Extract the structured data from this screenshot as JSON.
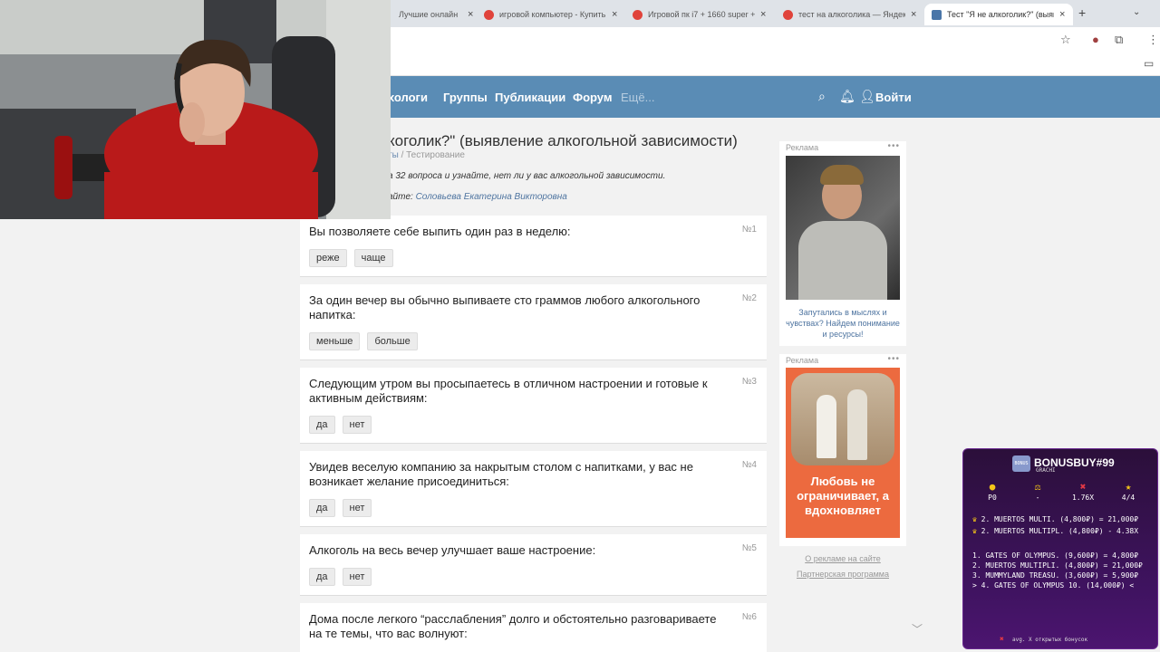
{
  "tabs": [
    {
      "title": "Лучшие онлайн",
      "favicon_color": "#888888"
    },
    {
      "title": "игровой компьютер - Купить",
      "favicon_color": "#e0433b"
    },
    {
      "title": "Игровой пк i7 + 1660 super +",
      "favicon_color": "#e0433b"
    },
    {
      "title": "тест на алкоголика — Яндекс",
      "favicon_color": "#e0433b"
    },
    {
      "title": "Тест \"Я не алкоголик?\" (выявл",
      "favicon_color": "#4a76a8"
    }
  ],
  "nav": {
    "links": [
      "хологи",
      "Группы",
      "Публикации",
      "Форум"
    ],
    "more": "Ещё...",
    "login": "Войти"
  },
  "page": {
    "title": "коголик?\" (выявление алкогольной зависимости)",
    "crumb_prefix": "ты",
    "crumb_current": "/ Тестирование",
    "intro": "а 32 вопроса и узнайте, нет ли у вас алкогольной зависимости.",
    "author_label": "айте:",
    "author_name": "Соловьева Екатерина Викторовна"
  },
  "questions": [
    {
      "num": "№1",
      "text": "Вы позволяете себе выпить один раз в неделю:",
      "options": [
        "реже",
        "чаще"
      ]
    },
    {
      "num": "№2",
      "text": "За один вечер вы обычно выпиваете сто граммов любого алкогольного напитка:",
      "options": [
        "меньше",
        "больше"
      ]
    },
    {
      "num": "№3",
      "text": "Следующим утром вы просыпаетесь в отличном настроении и готовые к активным действиям:",
      "options": [
        "да",
        "нет"
      ]
    },
    {
      "num": "№4",
      "text": "Увидев веселую компанию за накрытым столом с напитками, у вас не возникает желание присоединиться:",
      "options": [
        "да",
        "нет"
      ]
    },
    {
      "num": "№5",
      "text": "Алкоголь на весь вечер улучшает ваше настроение:",
      "options": [
        "да",
        "нет"
      ]
    },
    {
      "num": "№6",
      "text": "Дома после легкого “расслабления” долго и обстоятельно разговариваете на те темы, что вас волнуют:",
      "options": []
    }
  ],
  "ads": [
    {
      "label": "Реклама",
      "more": "•••",
      "caption": "Запутались в мыслях и чувствах? Найдем понимание и ресурсы!"
    },
    {
      "label": "Реклама",
      "more": "•••",
      "banner_text": "Любовь не ограничивает, а вдохновляет"
    }
  ],
  "footer_links": [
    "О рекламе на сайте",
    "Партнерская программа"
  ],
  "widget": {
    "title": "BONUSBUY#99",
    "subtitle": "GRACHI",
    "logo": "BONUS",
    "stats": [
      {
        "icon": "●",
        "value": "P0",
        "color": "#f5c518"
      },
      {
        "icon": "⚖",
        "value": "-",
        "color": "#f5c518"
      },
      {
        "icon": "✖",
        "value": "1.76X",
        "color": "#e53945"
      },
      {
        "icon": "★",
        "value": "4/4",
        "color": "#f5c518"
      }
    ],
    "top_lines": [
      "2. MUERTOS MULTI. (4,800₽) = 21,000₽",
      "2. MUERTOS MULTIPL. (4,800₽) - 4.38X"
    ],
    "list": [
      "1. GATES OF OLYMPUS. (9,600₽) =  4,800₽",
      "2. MUERTOS MULTIPLI. (4,800₽) = 21,000₽",
      "3. MUMMYLAND TREASU. (3,600₽) =  5,900₽",
      " > 4. GATES OF OLYMPUS 10. (14,000₽) <"
    ],
    "footer": "avg. X открытых бонусок"
  }
}
